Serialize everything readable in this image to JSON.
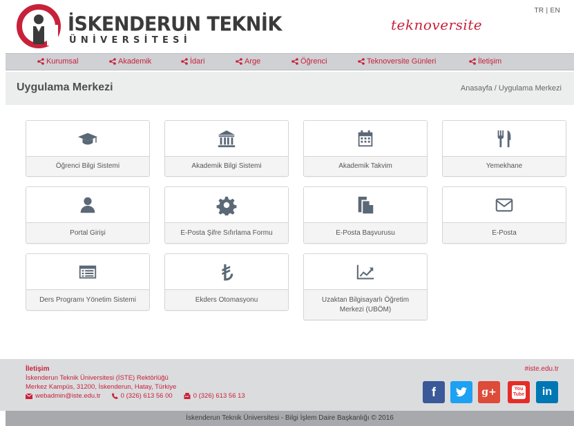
{
  "header": {
    "logo_title": "İSKENDERUN TEKNİK",
    "logo_sub": "ÜNİVERSİTESİ",
    "brand_right": "teknoversite",
    "lang": "TR | EN"
  },
  "nav": {
    "items": [
      {
        "label": "Kurumsal"
      },
      {
        "label": "Akademik"
      },
      {
        "label": "İdari"
      },
      {
        "label": "Arge"
      },
      {
        "label": "Öğrenci"
      },
      {
        "label": "Teknoversite Günleri"
      },
      {
        "label": "İletişim"
      }
    ],
    "icon": "share-icon"
  },
  "titlebar": {
    "title": "Uygulama Merkezi",
    "breadcrumb": "Anasayfa  /  Uygulama Merkezi"
  },
  "tiles": [
    {
      "label": "Öğrenci Bilgi Sistemi",
      "icon": "graduation-cap-icon"
    },
    {
      "label": "Akademik Bilgi Sistemi",
      "icon": "institution-icon"
    },
    {
      "label": "Akademik Takvim",
      "icon": "calendar-icon"
    },
    {
      "label": "Yemekhane",
      "icon": "cutlery-icon"
    },
    {
      "label": "Portal Girişi",
      "icon": "user-icon"
    },
    {
      "label": "E-Posta Şifre Sıfırlama Formu",
      "icon": "gear-icon"
    },
    {
      "label": "E-Posta Başvurusu",
      "icon": "copy-file-icon"
    },
    {
      "label": "E-Posta",
      "icon": "envelope-icon"
    },
    {
      "label": "Ders Programı Yönetim Sistemi",
      "icon": "list-alt-icon"
    },
    {
      "label": "Ekders Otomasyonu",
      "icon": "turkish-lira-icon"
    },
    {
      "label": "Uzaktan Bilgisayarlı Öğretim Merkezi (UBÖM)",
      "icon": "area-chart-icon"
    }
  ],
  "footer": {
    "title": "İletişim",
    "line1": "İskenderun Teknik Üniversitesi (İSTE) Rektörlüğü",
    "line2": "Merkez Kampüs, 31200, İskenderun, Hatay, Türkiye",
    "email": "webadmin@iste.edu.tr",
    "phone": "0 (326) 613 56 00",
    "fax": "0 (326) 613 56 13",
    "tag": "#iste.edu.tr",
    "social": [
      {
        "glyph": "f",
        "icon": "facebook-icon",
        "color": "#3b5998"
      },
      {
        "glyph": "t",
        "icon": "twitter-icon",
        "color": "#1da1f2"
      },
      {
        "glyph": "g+",
        "icon": "google-plus-icon",
        "color": "#dd4b39"
      },
      {
        "glyph": "You Tube",
        "icon": "youtube-icon",
        "color": "#e52d27"
      },
      {
        "glyph": "in",
        "icon": "linkedin-icon",
        "color": "#0077b5"
      }
    ]
  },
  "copyright": "İskenderun Teknik Üniversitesi - Bilgi İşlem Daire Başkanlığı © 2016",
  "colors": {
    "accent": "#c8213a",
    "icon": "#5b6876",
    "nav_bg": "#cfd1d4"
  }
}
